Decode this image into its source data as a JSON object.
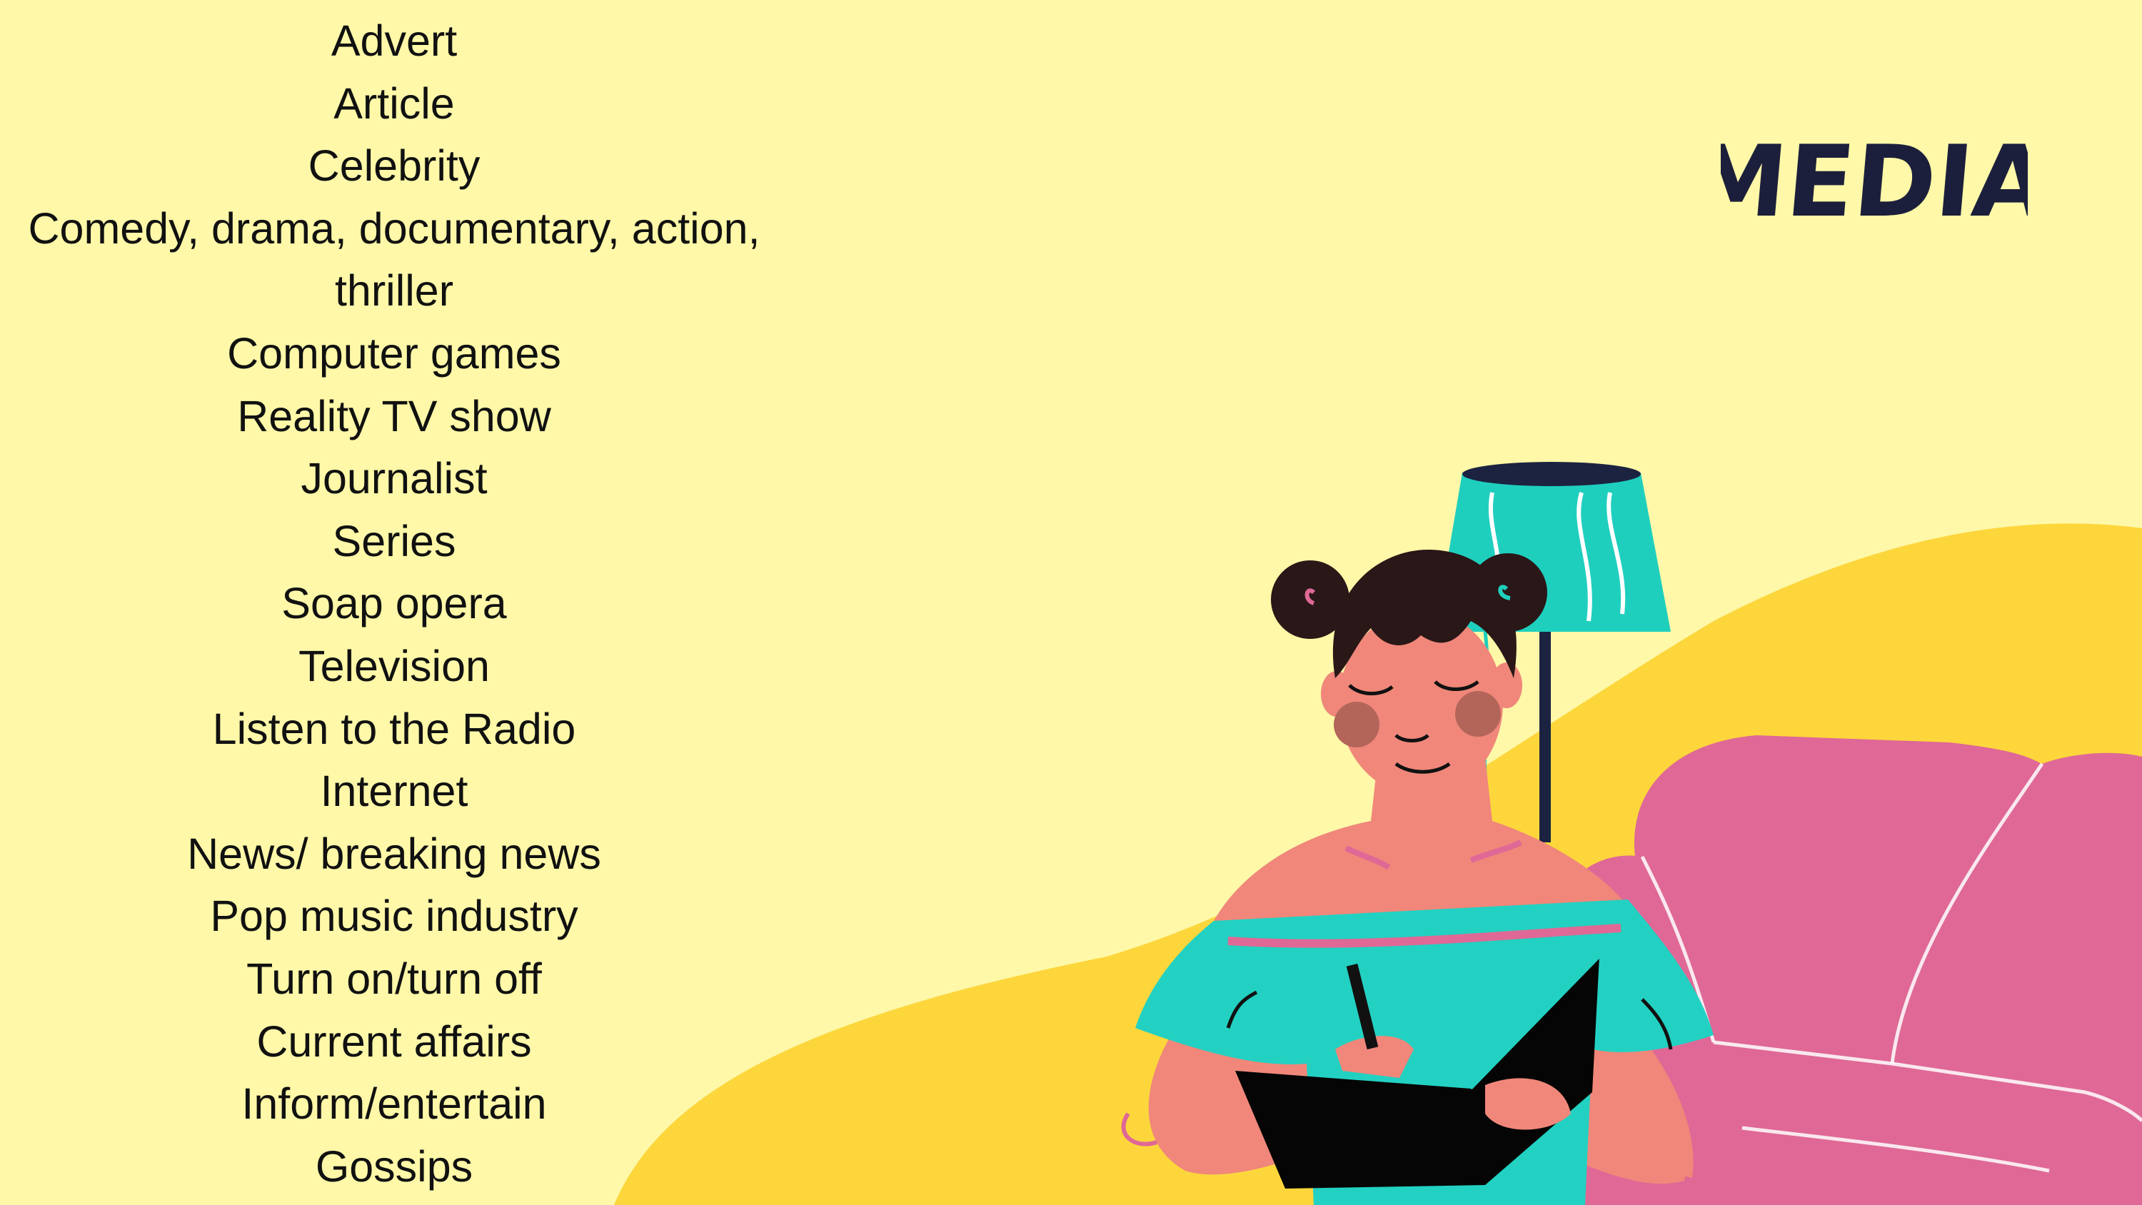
{
  "title": "MEDIA",
  "vocabulary": [
    "Advert",
    "Article",
    "Celebrity",
    "Comedy, drama, documentary, action,",
    "thriller",
    "Computer games",
    "Reality TV show",
    "Journalist",
    "Series",
    "Soap opera",
    "Television",
    "Listen to the Radio",
    "Internet",
    "News/ breaking news",
    "Pop music industry",
    "Turn on/turn off",
    "Current affairs",
    "Inform/entertain",
    "Gossips"
  ],
  "colors": {
    "background": "#FEF8A8",
    "hill": "#FDD63C",
    "sofa": "#DF6896",
    "lamp_shade": "#1FCFBE",
    "dress": "#22D1C2",
    "skin": "#F0877A",
    "ink": "#1C1F3B",
    "text": "#111111"
  }
}
